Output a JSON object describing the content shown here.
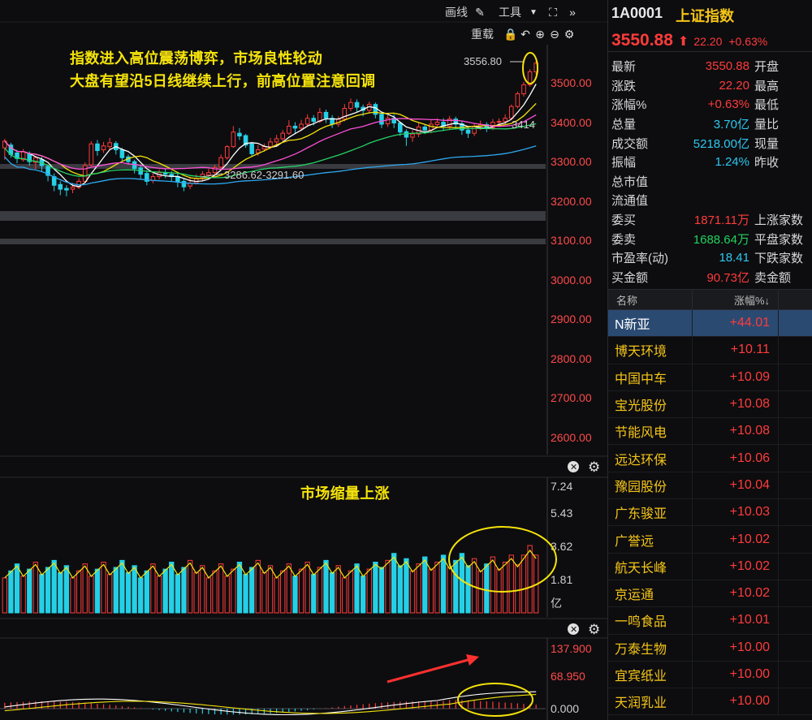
{
  "toolbar": {
    "draw_label": "画线",
    "tools_label": "工具",
    "reload_label": "重载"
  },
  "annotations": {
    "line1": "指数进入高位震荡博弈，市场良性轮动",
    "line2": "大盘有望沿5日线继续上行，前高位置注意回调",
    "volume_note": "市场缩量上涨"
  },
  "chart_labels": {
    "high_mark": "3556.80",
    "low_mark": "3286.62-3291.60",
    "level_mark": "3414"
  },
  "price_axis": [
    "3500.00",
    "3400.00",
    "3300.00",
    "3200.00",
    "3100.00",
    "3000.00",
    "2900.00",
    "2800.00",
    "2700.00",
    "2600.00"
  ],
  "volume_axis": [
    "7.24",
    "5.43",
    "3.62",
    "1.81",
    "亿"
  ],
  "macd_axis": [
    "137.900",
    "68.950",
    "0.000"
  ],
  "quote": {
    "code": "1A0001",
    "name": "上证指数",
    "price": "3550.88",
    "change": "22.20",
    "change_pct": "+0.63%"
  },
  "stats": [
    {
      "label": "最新",
      "value": "3550.88",
      "color": "red",
      "label2": "开盘"
    },
    {
      "label": "涨跌",
      "value": "22.20",
      "color": "red",
      "label2": "最高"
    },
    {
      "label": "涨幅%",
      "value": "+0.63%",
      "color": "red",
      "label2": "最低"
    },
    {
      "label": "总量",
      "value": "3.70亿",
      "color": "cyan",
      "label2": "量比"
    },
    {
      "label": "成交额",
      "value": "5218.00亿",
      "color": "cyan",
      "label2": "现量"
    },
    {
      "label": "振幅",
      "value": "1.24%",
      "color": "cyan",
      "label2": "昨收"
    },
    {
      "label": "总市值",
      "value": "",
      "color": "white",
      "label2": ""
    },
    {
      "label": "流通值",
      "value": "",
      "color": "white",
      "label2": ""
    },
    {
      "label": "委买",
      "value": "1871.11万",
      "color": "red",
      "label2": "上涨家数"
    },
    {
      "label": "委卖",
      "value": "1688.64万",
      "color": "green",
      "label2": "平盘家数"
    },
    {
      "label": "市盈率(动)",
      "value": "18.41",
      "color": "cyan",
      "label2": "下跌家数"
    },
    {
      "label": "买金额",
      "value": "90.73亿",
      "color": "red",
      "label2": "卖金额"
    }
  ],
  "list_header": {
    "name": "名称",
    "pct": "涨幅%↓"
  },
  "stocks": [
    {
      "name": "N新亚",
      "pct": "+44.01",
      "selected": true
    },
    {
      "name": "博天环境",
      "pct": "+10.11"
    },
    {
      "name": "中国中车",
      "pct": "+10.09"
    },
    {
      "name": "宝光股份",
      "pct": "+10.08"
    },
    {
      "name": "节能风电",
      "pct": "+10.08"
    },
    {
      "name": "远达环保",
      "pct": "+10.06"
    },
    {
      "name": "豫园股份",
      "pct": "+10.04"
    },
    {
      "name": "广东骏亚",
      "pct": "+10.03"
    },
    {
      "name": "广誉远",
      "pct": "+10.02"
    },
    {
      "name": "航天长峰",
      "pct": "+10.02"
    },
    {
      "name": "京运通",
      "pct": "+10.02"
    },
    {
      "name": "一鸣食品",
      "pct": "+10.01"
    },
    {
      "name": "万泰生物",
      "pct": "+10.00"
    },
    {
      "name": "宜宾纸业",
      "pct": "+10.00"
    },
    {
      "name": "天润乳业",
      "pct": "+10.00"
    }
  ],
  "chart_data": {
    "type": "candlestick",
    "price_range": [
      2560,
      3580
    ],
    "candles": [
      [
        3335,
        3352,
        3305,
        3358
      ],
      [
        3342,
        3318,
        3310,
        3348
      ],
      [
        3322,
        3308,
        3296,
        3330
      ],
      [
        3305,
        3325,
        3300,
        3332
      ],
      [
        3320,
        3300,
        3290,
        3326
      ],
      [
        3298,
        3310,
        3280,
        3315
      ],
      [
        3305,
        3290,
        3275,
        3312
      ],
      [
        3288,
        3265,
        3250,
        3292
      ],
      [
        3262,
        3240,
        3225,
        3270
      ],
      [
        3242,
        3230,
        3215,
        3250
      ],
      [
        3232,
        3228,
        3212,
        3240
      ],
      [
        3230,
        3235,
        3220,
        3246
      ],
      [
        3235,
        3250,
        3230,
        3258
      ],
      [
        3250,
        3290,
        3245,
        3298
      ],
      [
        3292,
        3345,
        3288,
        3352
      ],
      [
        3345,
        3328,
        3315,
        3355
      ],
      [
        3330,
        3340,
        3322,
        3350
      ],
      [
        3338,
        3348,
        3330,
        3360
      ],
      [
        3346,
        3330,
        3318,
        3352
      ],
      [
        3330,
        3310,
        3300,
        3335
      ],
      [
        3312,
        3300,
        3292,
        3318
      ],
      [
        3300,
        3282,
        3270,
        3305
      ],
      [
        3284,
        3268,
        3255,
        3290
      ],
      [
        3270,
        3250,
        3240,
        3278
      ],
      [
        3252,
        3262,
        3245,
        3270
      ],
      [
        3262,
        3272,
        3255,
        3280
      ],
      [
        3272,
        3268,
        3258,
        3282
      ],
      [
        3268,
        3262,
        3250,
        3276
      ],
      [
        3262,
        3248,
        3235,
        3270
      ],
      [
        3250,
        3236,
        3225,
        3256
      ],
      [
        3238,
        3245,
        3230,
        3262
      ],
      [
        3246,
        3258,
        3242,
        3268
      ],
      [
        3258,
        3268,
        3252,
        3276
      ],
      [
        3266,
        3272,
        3260,
        3282
      ],
      [
        3272,
        3285,
        3268,
        3292
      ],
      [
        3286,
        3310,
        3282,
        3318
      ],
      [
        3310,
        3338,
        3305,
        3342
      ],
      [
        3338,
        3375,
        3335,
        3390
      ],
      [
        3372,
        3365,
        3355,
        3385
      ],
      [
        3366,
        3342,
        3335,
        3370
      ],
      [
        3345,
        3320,
        3312,
        3350
      ],
      [
        3322,
        3330,
        3315,
        3342
      ],
      [
        3332,
        3338,
        3325,
        3346
      ],
      [
        3338,
        3350,
        3332,
        3360
      ],
      [
        3350,
        3358,
        3342,
        3368
      ],
      [
        3358,
        3372,
        3352,
        3380
      ],
      [
        3372,
        3390,
        3368,
        3405
      ],
      [
        3390,
        3385,
        3372,
        3400
      ],
      [
        3385,
        3395,
        3378,
        3406
      ],
      [
        3395,
        3410,
        3388,
        3420
      ],
      [
        3410,
        3402,
        3392,
        3418
      ],
      [
        3402,
        3425,
        3398,
        3436
      ],
      [
        3425,
        3410,
        3398,
        3432
      ],
      [
        3410,
        3395,
        3385,
        3418
      ],
      [
        3395,
        3408,
        3388,
        3415
      ],
      [
        3408,
        3435,
        3402,
        3446
      ],
      [
        3435,
        3450,
        3428,
        3460
      ],
      [
        3450,
        3438,
        3425,
        3458
      ],
      [
        3438,
        3430,
        3415,
        3445
      ],
      [
        3430,
        3445,
        3422,
        3452
      ],
      [
        3445,
        3420,
        3410,
        3450
      ],
      [
        3420,
        3395,
        3385,
        3425
      ],
      [
        3396,
        3410,
        3388,
        3418
      ],
      [
        3410,
        3398,
        3385,
        3420
      ],
      [
        3398,
        3375,
        3365,
        3402
      ],
      [
        3376,
        3362,
        3340,
        3382
      ],
      [
        3362,
        3370,
        3350,
        3380
      ],
      [
        3370,
        3388,
        3362,
        3398
      ],
      [
        3388,
        3380,
        3370,
        3395
      ],
      [
        3380,
        3395,
        3372,
        3405
      ],
      [
        3394,
        3400,
        3386,
        3410
      ],
      [
        3400,
        3390,
        3378,
        3410
      ],
      [
        3390,
        3408,
        3382,
        3416
      ],
      [
        3408,
        3395,
        3382,
        3414
      ],
      [
        3396,
        3380,
        3368,
        3402
      ],
      [
        3380,
        3372,
        3360,
        3388
      ],
      [
        3372,
        3390,
        3365,
        3398
      ],
      [
        3390,
        3394,
        3380,
        3404
      ],
      [
        3394,
        3386,
        3375,
        3400
      ],
      [
        3386,
        3400,
        3380,
        3408
      ],
      [
        3400,
        3402,
        3390,
        3410
      ],
      [
        3402,
        3410,
        3395,
        3420
      ],
      [
        3410,
        3440,
        3405,
        3445
      ],
      [
        3440,
        3472,
        3435,
        3478
      ],
      [
        3472,
        3495,
        3465,
        3502
      ],
      [
        3495,
        3528,
        3490,
        3535
      ],
      [
        3528,
        3550,
        3520,
        3557
      ]
    ],
    "ma_lines": [
      "#ffffff",
      "#f5e30a",
      "#ff4fd8",
      "#25d366",
      "#2ea8f0"
    ],
    "volume_range": [
      0,
      7.24
    ],
    "macd_range": [
      -20,
      137.9
    ]
  }
}
